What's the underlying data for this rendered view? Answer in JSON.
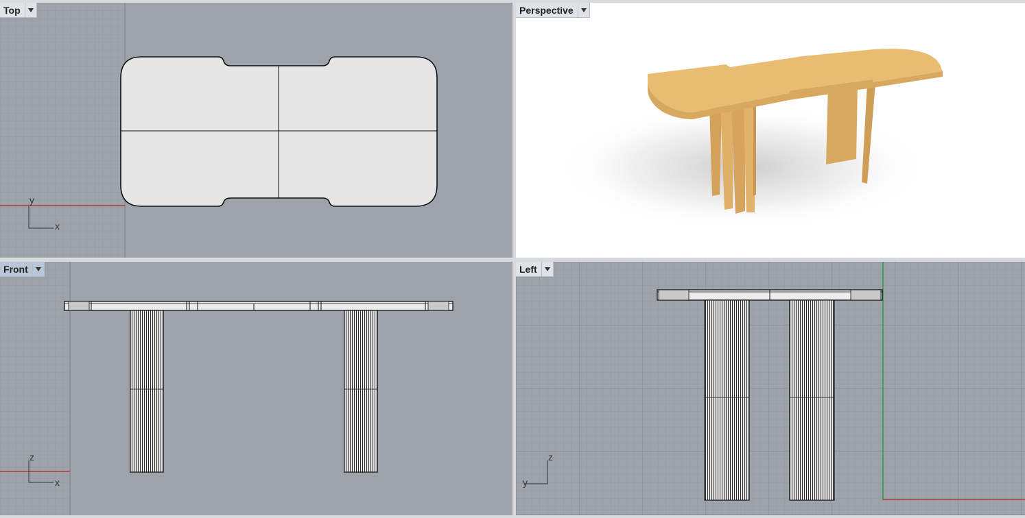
{
  "viewports": {
    "top": {
      "label": "Top",
      "axis_labels": {
        "x": "x",
        "y": "y"
      }
    },
    "perspective": {
      "label": "Perspective",
      "model_color": "#e8bd72"
    },
    "front": {
      "label": "Front",
      "axis_labels": {
        "x": "x",
        "z": "z"
      }
    },
    "left": {
      "label": "Left",
      "axis_labels": {
        "y": "y",
        "z": "z"
      }
    }
  },
  "colors": {
    "grid_bg": "#9ea3ab",
    "grid_line": "#8f959d",
    "major_line": "#6f757d",
    "x_axis": "#b03a3a",
    "y_axis": "#2d9a3a",
    "surface_fill": "#e6e6e6",
    "wire": "#111111"
  }
}
